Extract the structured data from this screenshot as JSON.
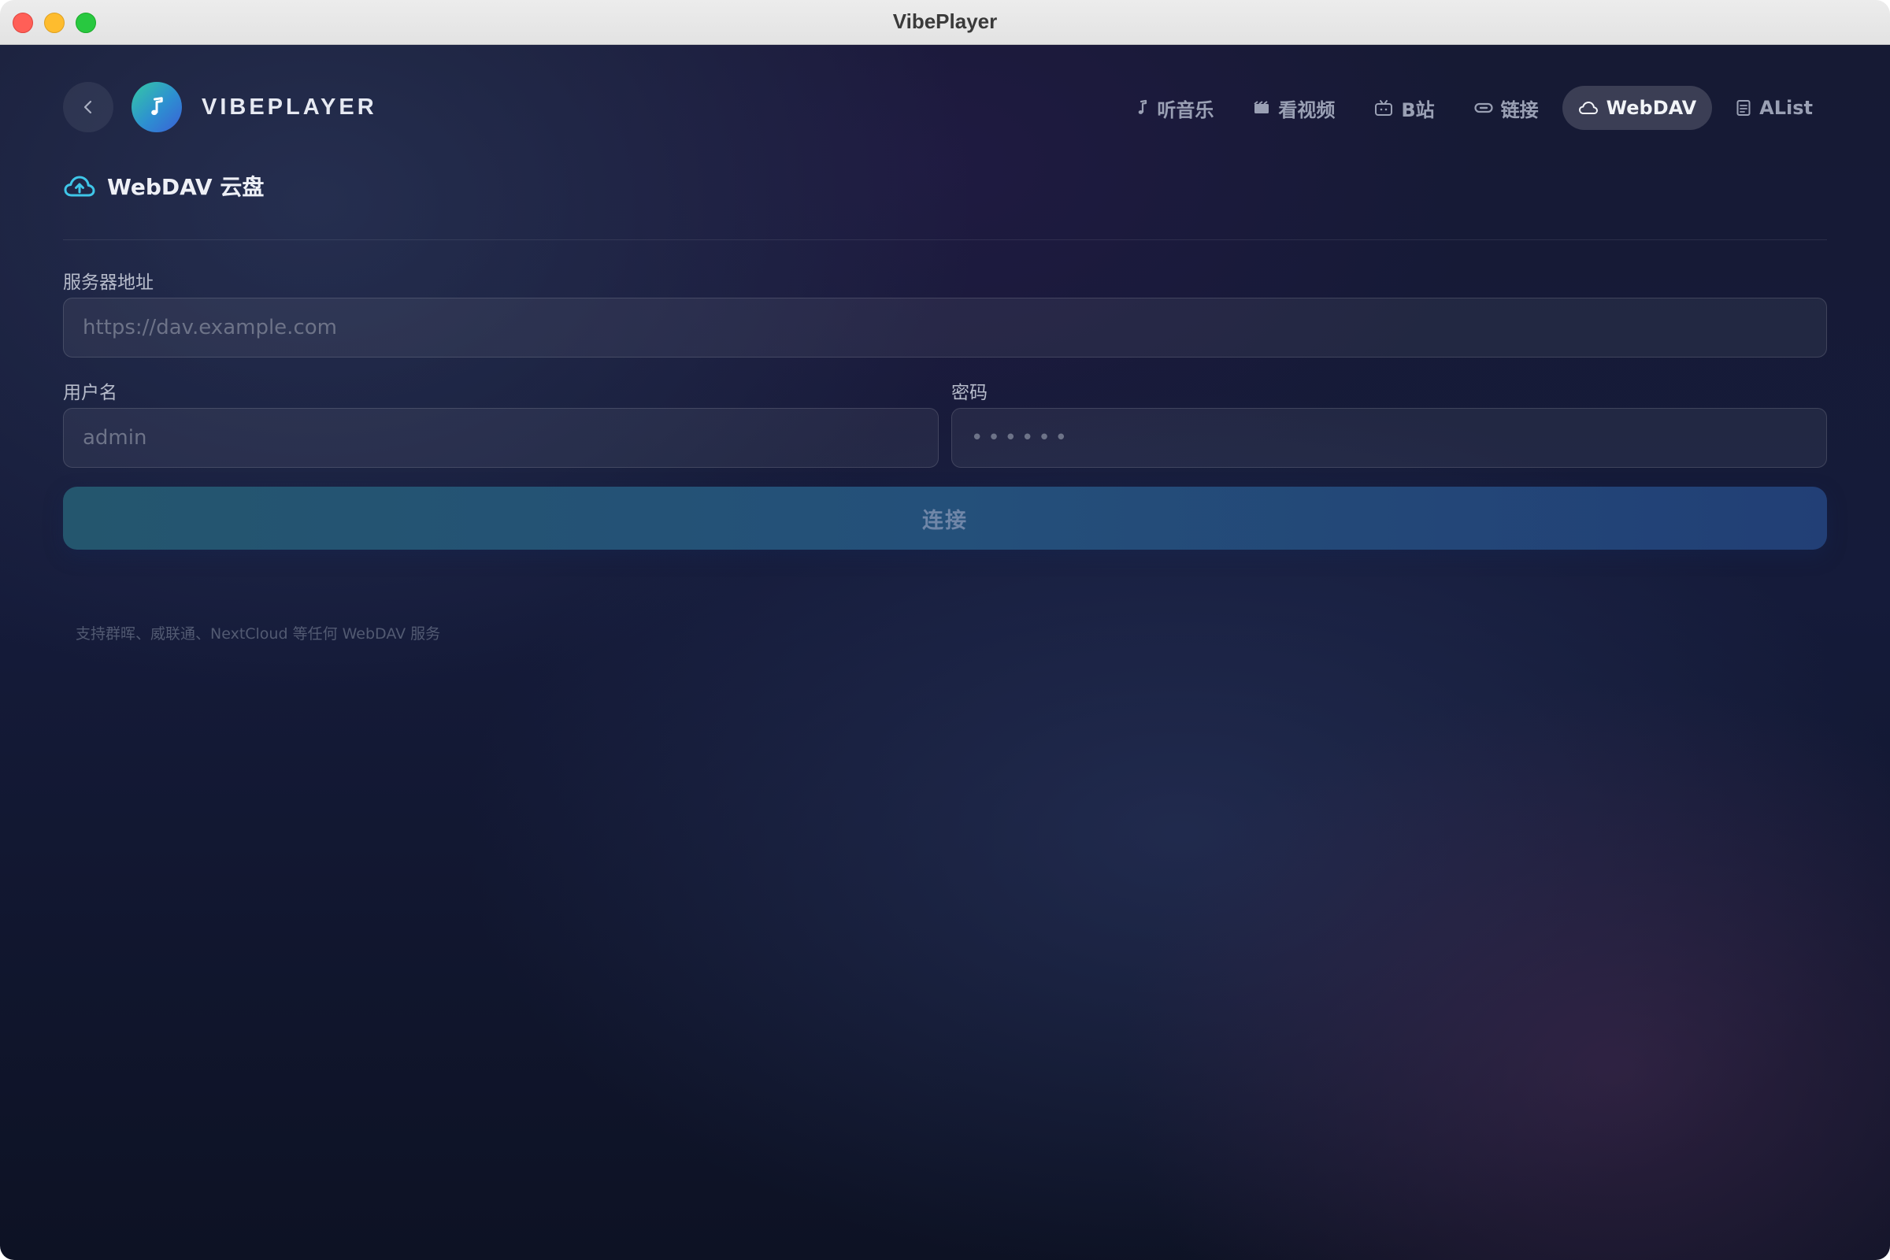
{
  "window": {
    "title": "VibePlayer"
  },
  "header": {
    "back_icon": "chevron-left-icon",
    "logo_icon": "music-note-icon",
    "brand": "VIBEPLAYER"
  },
  "nav": {
    "items": [
      {
        "label": "听音乐",
        "icon": "music-note-icon",
        "active": false
      },
      {
        "label": "看视频",
        "icon": "film-icon",
        "active": false
      },
      {
        "label": "B站",
        "icon": "tv-icon",
        "active": false
      },
      {
        "label": "链接",
        "icon": "link-icon",
        "active": false
      },
      {
        "label": "WebDAV",
        "icon": "cloud-icon",
        "active": true
      },
      {
        "label": "AList",
        "icon": "document-icon",
        "active": false
      }
    ]
  },
  "section": {
    "icon": "cloud-upload-icon",
    "title": "WebDAV 云盘"
  },
  "form": {
    "server": {
      "label": "服务器地址",
      "placeholder": "https://dav.example.com",
      "value": ""
    },
    "username": {
      "label": "用户名",
      "placeholder": "admin",
      "value": ""
    },
    "password": {
      "label": "密码",
      "placeholder": "••••••",
      "value": ""
    },
    "connect_label": "连接",
    "hint": "支持群晖、威联通、NextCloud 等任何 WebDAV 服务"
  },
  "colors": {
    "accent": "#3fc6e8",
    "active_nav_bg": "#3a3e52",
    "button_gradient_start": "#24566e",
    "button_gradient_end": "#223f76"
  }
}
